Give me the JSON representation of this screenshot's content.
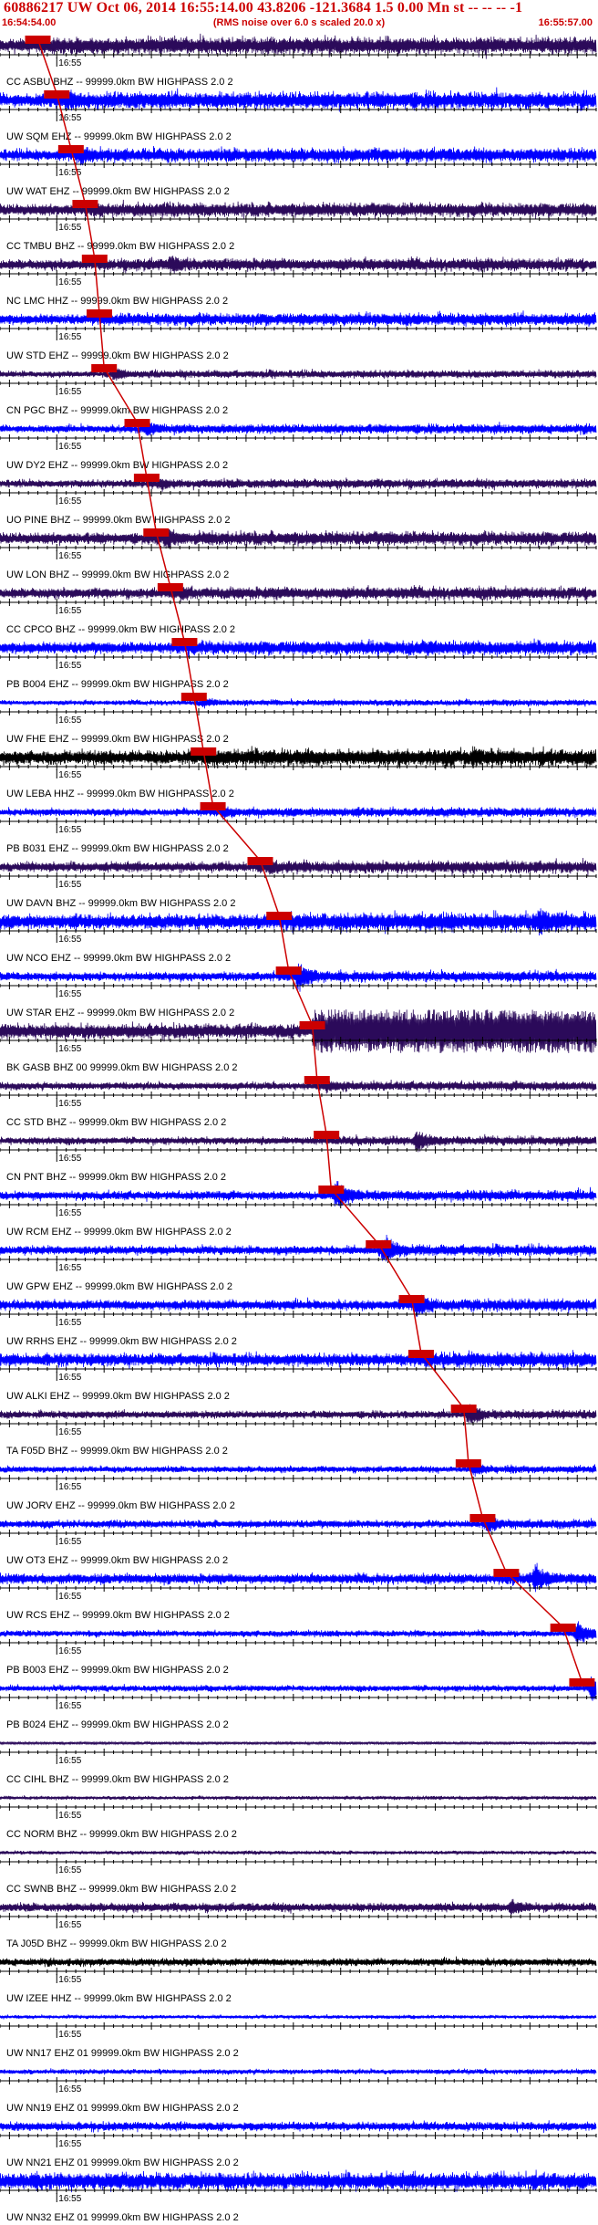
{
  "header": {
    "title": "60886217 UW Oct 06, 2014 16:55:14.00   43.8206 -121.3684  1.5 0.00 Mn st -- -- --  -1",
    "start_time": "16:54:54.00",
    "end_time": "16:55:57.00",
    "rms_note": "(RMS noise over 6.0 s scaled 20.0 x)"
  },
  "colors": {
    "header_text": "#cc0000",
    "pick_fill": "#cc0000",
    "axis": "#000000",
    "trace_blue": "#0000ff",
    "trace_purple": "#2b0a5a",
    "trace_black": "#000000",
    "background": "#ffffff"
  },
  "chart_data": {
    "type": "seismogram",
    "time_range": [
      "16:54:54.00",
      "16:55:57.00"
    ],
    "time_tick_label": "16:55",
    "title": "60886217 UW Oct 06, 2014 16:55:14.00   43.8206 -121.3684  1.5 0.00 Mn st -- -- --  -1",
    "series": [
      {
        "name": "CC ASBU BHZ -- 99999.0km BW  HIGHPASS  2.0  2",
        "color": "purple",
        "pick_time_s": 4.0,
        "amplitude": 0.55,
        "burst_time_s": 8.0,
        "burst_amp": 0.6
      },
      {
        "name": "UW SQM EHZ -- 99999.0km BW  HIGHPASS  2.0  2",
        "color": "blue",
        "pick_time_s": 6.0,
        "amplitude": 0.55,
        "burst_time_s": 7.0,
        "burst_amp": 0.8
      },
      {
        "name": "UW WAT EHZ -- 99999.0km BW  HIGHPASS  2.0  2",
        "color": "blue",
        "pick_time_s": 7.5,
        "amplitude": 0.45,
        "burst_time_s": 8.5,
        "burst_amp": 0.8
      },
      {
        "name": "CC TMBU BHZ -- 99999.0km BW  HIGHPASS  2.0  2",
        "color": "purple",
        "pick_time_s": 9.0,
        "amplitude": 0.45,
        "burst_time_s": 10.0,
        "burst_amp": 0.6
      },
      {
        "name": "NC LMC HHZ -- 99999.0km BW  HIGHPASS  2.0  2",
        "color": "purple",
        "pick_time_s": 10.0,
        "amplitude": 0.4,
        "burst_time_s": 18.0,
        "burst_amp": 0.7
      },
      {
        "name": "UW STD EHZ -- 99999.0km BW  HIGHPASS  2.0  2",
        "color": "blue",
        "pick_time_s": 10.5,
        "amplitude": 0.4,
        "burst_time_s": 62.0,
        "burst_amp": 0.5
      },
      {
        "name": "CN PGC BHZ -- 99999.0km BW  HIGHPASS  2.0  2",
        "color": "purple",
        "pick_time_s": 11.0,
        "amplitude": 0.25,
        "burst_time_s": 12.0,
        "burst_amp": 0.5
      },
      {
        "name": "UW DY2 EHZ -- 99999.0km BW  HIGHPASS  2.0  2",
        "color": "blue",
        "pick_time_s": 14.5,
        "amplitude": 0.3,
        "burst_time_s": 15.5,
        "burst_amp": 0.6
      },
      {
        "name": "UO PINE BHZ -- 99999.0km BW  HIGHPASS  2.0  2",
        "color": "purple",
        "pick_time_s": 15.5,
        "amplitude": 0.3,
        "burst_time_s": 17.0,
        "burst_amp": 0.5
      },
      {
        "name": "UW LON BHZ -- 99999.0km BW  HIGHPASS  2.0  2",
        "color": "purple",
        "pick_time_s": 16.5,
        "amplitude": 0.45,
        "burst_time_s": 17.5,
        "burst_amp": 0.8
      },
      {
        "name": "CC CPCO BHZ -- 99999.0km BW  HIGHPASS  2.0  2",
        "color": "purple",
        "pick_time_s": 18.0,
        "amplitude": 0.4,
        "burst_time_s": 19.0,
        "burst_amp": 0.6
      },
      {
        "name": "PB B004 EHZ -- 99999.0km BW  HIGHPASS  2.0  2",
        "color": "blue",
        "pick_time_s": 19.5,
        "amplitude": 0.45,
        "burst_time_s": 45.0,
        "burst_amp": 0.6
      },
      {
        "name": "UW FHE EHZ -- 99999.0km BW  HIGHPASS  2.0  2",
        "color": "blue",
        "pick_time_s": 20.5,
        "amplitude": 0.2,
        "burst_time_s": 21.5,
        "burst_amp": 0.4
      },
      {
        "name": "UW LEBA HHZ -- 99999.0km BW  HIGHPASS  2.0  2",
        "color": "black",
        "pick_time_s": 21.5,
        "amplitude": 0.55,
        "burst_time_s": 50.0,
        "burst_amp": 0.8
      },
      {
        "name": "PB B031 EHZ -- 99999.0km BW  HIGHPASS  2.0  2",
        "color": "blue",
        "pick_time_s": 22.5,
        "amplitude": 0.3,
        "burst_time_s": 23.5,
        "burst_amp": 0.5
      },
      {
        "name": "UW DAVN BHZ -- 99999.0km BW  HIGHPASS  2.0  2",
        "color": "purple",
        "pick_time_s": 27.5,
        "amplitude": 0.4,
        "burst_time_s": 28.5,
        "burst_amp": 0.6
      },
      {
        "name": "UW NCO EHZ -- 99999.0km BW  HIGHPASS  2.0  2",
        "color": "blue",
        "pick_time_s": 29.5,
        "amplitude": 0.6,
        "burst_time_s": 57.0,
        "burst_amp": 1.0
      },
      {
        "name": "UW STAR EHZ -- 99999.0km BW  HIGHPASS  2.0  2",
        "color": "blue",
        "pick_time_s": 30.5,
        "amplitude": 0.35,
        "burst_time_s": 31.5,
        "burst_amp": 0.9
      },
      {
        "name": "BK GASB BHZ 00 99999.0km BW  HIGHPASS  2.0  2",
        "color": "purple",
        "pick_time_s": 33.0,
        "amplitude": 0.6,
        "burst_time_s": 48.0,
        "burst_amp": 1.0,
        "saturated_after_s": 33.0
      },
      {
        "name": "CC STD BHZ -- 99999.0km BW  HIGHPASS  2.0  2",
        "color": "purple",
        "pick_time_s": 33.5,
        "amplitude": 0.3,
        "burst_time_s": 34.5,
        "burst_amp": 0.5
      },
      {
        "name": "CN PNT BHZ -- 99999.0km BW  HIGHPASS  2.0  2",
        "color": "purple",
        "pick_time_s": 34.5,
        "amplitude": 0.3,
        "burst_time_s": 44.0,
        "burst_amp": 0.8
      },
      {
        "name": "UW RCM EHZ -- 99999.0km BW  HIGHPASS  2.0  2",
        "color": "blue",
        "pick_time_s": 35.0,
        "amplitude": 0.35,
        "burst_time_s": 35.5,
        "burst_amp": 1.0
      },
      {
        "name": "UW GPW EHZ -- 99999.0km BW  HIGHPASS  2.0  2",
        "color": "blue",
        "pick_time_s": 40.0,
        "amplitude": 0.35,
        "burst_time_s": 40.5,
        "burst_amp": 1.0
      },
      {
        "name": "UW RRHS EHZ -- 99999.0km BW  HIGHPASS  2.0  2",
        "color": "blue",
        "pick_time_s": 43.5,
        "amplitude": 0.4,
        "burst_time_s": 44.0,
        "burst_amp": 0.9
      },
      {
        "name": "UW ALKI EHZ -- 99999.0km BW  HIGHPASS  2.0  2",
        "color": "blue",
        "pick_time_s": 44.5,
        "amplitude": 0.5,
        "burst_time_s": 45.0,
        "burst_amp": 0.6
      },
      {
        "name": "TA F05D BHZ -- 99999.0km BW  HIGHPASS  2.0  2",
        "color": "purple",
        "pick_time_s": 49.0,
        "amplitude": 0.3,
        "burst_time_s": 49.5,
        "burst_amp": 0.8
      },
      {
        "name": "UW JORV EHZ -- 99999.0km BW  HIGHPASS  2.0  2",
        "color": "blue",
        "pick_time_s": 49.5,
        "amplitude": 0.25,
        "burst_time_s": 50.0,
        "burst_amp": 0.5
      },
      {
        "name": "UW OT3 EHZ -- 99999.0km BW  HIGHPASS  2.0  2",
        "color": "blue",
        "pick_time_s": 51.0,
        "amplitude": 0.3,
        "burst_time_s": 51.5,
        "burst_amp": 0.6
      },
      {
        "name": "UW RCS EHZ -- 99999.0km BW  HIGHPASS  2.0  2",
        "color": "blue",
        "pick_time_s": 53.5,
        "amplitude": 0.4,
        "burst_time_s": 56.5,
        "burst_amp": 1.0
      },
      {
        "name": "PB B003 EHZ -- 99999.0km BW  HIGHPASS  2.0  2",
        "color": "blue",
        "pick_time_s": 59.5,
        "amplitude": 0.25,
        "burst_time_s": 61.0,
        "burst_amp": 0.8
      },
      {
        "name": "PB B024 EHZ -- 99999.0km BW  HIGHPASS  2.0  2",
        "color": "blue",
        "pick_time_s": 61.5,
        "amplitude": 0.25,
        "burst_time_s": 62.5,
        "burst_amp": 0.9
      },
      {
        "name": "CC CIHL BHZ -- 99999.0km BW  HIGHPASS  2.0  2",
        "color": "purple",
        "amplitude": 0.1
      },
      {
        "name": "CC NORM BHZ -- 99999.0km BW  HIGHPASS  2.0  2",
        "color": "purple",
        "amplitude": 0.15
      },
      {
        "name": "CC SWNB BHZ -- 99999.0km BW  HIGHPASS  2.0  2",
        "color": "purple",
        "amplitude": 0.15
      },
      {
        "name": "TA J05D BHZ -- 99999.0km BW  HIGHPASS  2.0  2",
        "color": "purple",
        "amplitude": 0.35,
        "burst_time_s": 54.0,
        "burst_amp": 0.6
      },
      {
        "name": "UW IZEE HHZ -- 99999.0km BW  HIGHPASS  2.0  2",
        "color": "black",
        "amplitude": 0.3
      },
      {
        "name": "UW NN17 EHZ 01 99999.0km BW  HIGHPASS  2.0  2",
        "color": "blue",
        "amplitude": 0.15
      },
      {
        "name": "UW NN19 EHZ 01 99999.0km BW  HIGHPASS  2.0  2",
        "color": "blue",
        "amplitude": 0.2
      },
      {
        "name": "UW NN21 EHZ 01 99999.0km BW  HIGHPASS  2.0  2",
        "color": "blue",
        "amplitude": 0.35
      },
      {
        "name": "UW NN32 EHZ 01 99999.0km BW  HIGHPASS  2.0  2",
        "color": "blue",
        "amplitude": 0.7
      }
    ]
  }
}
